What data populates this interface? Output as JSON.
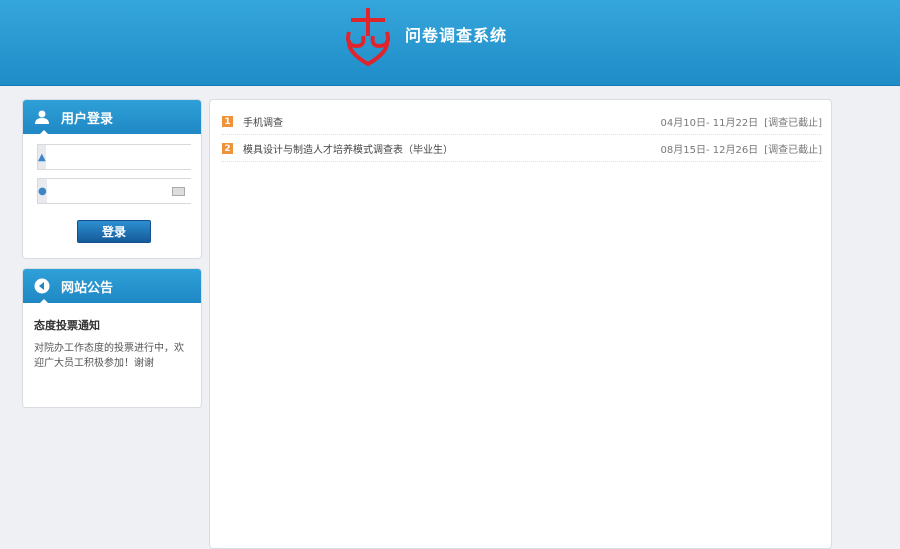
{
  "header": {
    "title": "问卷调查系统",
    "logo_text": "吉"
  },
  "login": {
    "title": "用户登录",
    "username_placeholder": "",
    "password_placeholder": "",
    "button": "登录"
  },
  "notice": {
    "title": "网站公告",
    "item_title": "态度投票通知",
    "item_text": "对院办工作态度的投票进行中，欢迎广大员工积极参加！谢谢"
  },
  "surveys": [
    {
      "num": "1",
      "title": "手机调查",
      "dates": "04月10日- 11月22日",
      "status": "[调查已截止]"
    },
    {
      "num": "2",
      "title": "模具设计与制造人才培养模式调查表（毕业生）",
      "dates": "08月15日- 12月26日",
      "status": "[调查已截止]"
    }
  ],
  "colors": {
    "header": "#2a9bd4",
    "accent_orange": "#f0923a",
    "logo_red": "#e0242c"
  }
}
